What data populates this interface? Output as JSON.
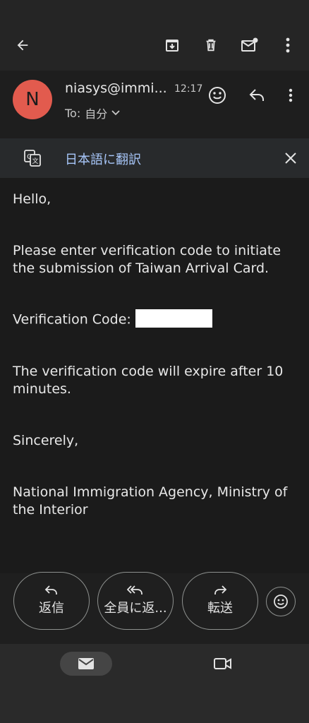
{
  "header": {
    "avatar_letter": "N",
    "sender": "niasys@immi...",
    "time": "12:17",
    "to_label": "To:",
    "to_value": "自分"
  },
  "translate": {
    "label": "日本語に翻訳"
  },
  "message": {
    "greeting": "Hello,",
    "line1": "Please enter verification code to initiate the submission of Taiwan Arrival Card.",
    "code_label": "Verification Code:",
    "expire": "The verification code will expire after 10 minutes.",
    "closing": "Sincerely,",
    "signature": "National Immigration Agency, Ministry of the Interior"
  },
  "actions": {
    "reply": "返信",
    "reply_all": "全員に返...",
    "forward": "転送"
  },
  "colors": {
    "avatar": "#e25b4e",
    "link": "#a8c7fa",
    "background": "#1f1f1f"
  }
}
